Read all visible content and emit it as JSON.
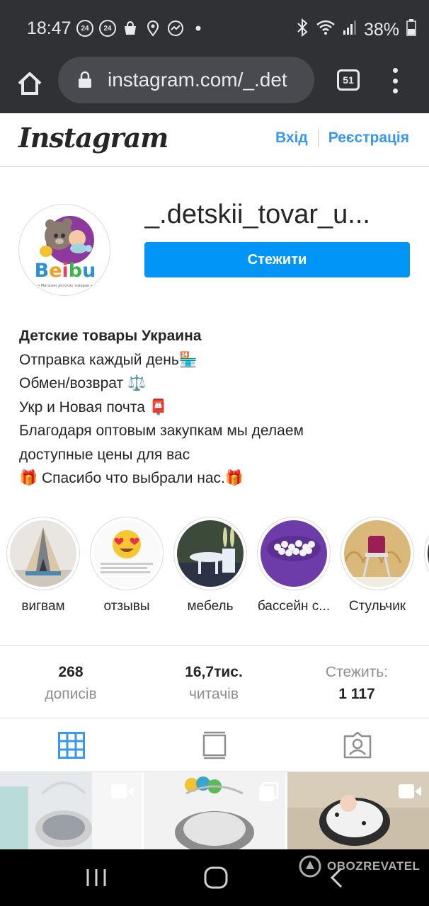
{
  "status_bar": {
    "time": "18:47",
    "notif_badges": [
      "24",
      "24"
    ],
    "battery": "38%"
  },
  "browser": {
    "url": "instagram.com/_.det",
    "tabs_count": "51"
  },
  "ig_header": {
    "logo": "Instagram",
    "login": "Вхід",
    "signup": "Реєстрація"
  },
  "profile": {
    "username": "_.detskii_tovar_u...",
    "follow_label": "Стежити",
    "avatar_brand": "Beibu",
    "avatar_tagline": "• Магазин детских товаров •",
    "bio": {
      "name": "Детские товары Украина",
      "lines": [
        "Отправка каждый день🏪",
        "Обмен/возврат ⚖️",
        "Укр и Новая почта 📮",
        "Благодаря оптовым закупкам мы делаем",
        "доступные цены для вас",
        "🎁 Спасибо что выбрали нас.🎁"
      ]
    }
  },
  "highlights": [
    {
      "label": "вигвам",
      "icon": "teepee-tent-image"
    },
    {
      "label": "отзывы",
      "icon": "heart-eyes-emoji-image"
    },
    {
      "label": "мебель",
      "icon": "kids-table-chairs-image"
    },
    {
      "label": "бассейн с...",
      "icon": "ball-pit-image"
    },
    {
      "label": "Стульчик",
      "icon": "high-chair-image"
    }
  ],
  "stats": {
    "posts_num": "268",
    "posts_label": "дописів",
    "followers_num": "16,7тис.",
    "followers_label": "читачів",
    "following_label": "Стежить:",
    "following_num": "1 117"
  },
  "tabs": [
    {
      "name": "grid",
      "icon": "grid-icon",
      "active": true
    },
    {
      "name": "feed",
      "icon": "feed-icon",
      "active": false
    },
    {
      "name": "tagged",
      "icon": "tagged-icon",
      "active": false
    }
  ],
  "watermark": "OBOZREVATEL",
  "colors": {
    "accent": "#0095f6",
    "link": "#3897f0",
    "chrome": "#303134"
  }
}
